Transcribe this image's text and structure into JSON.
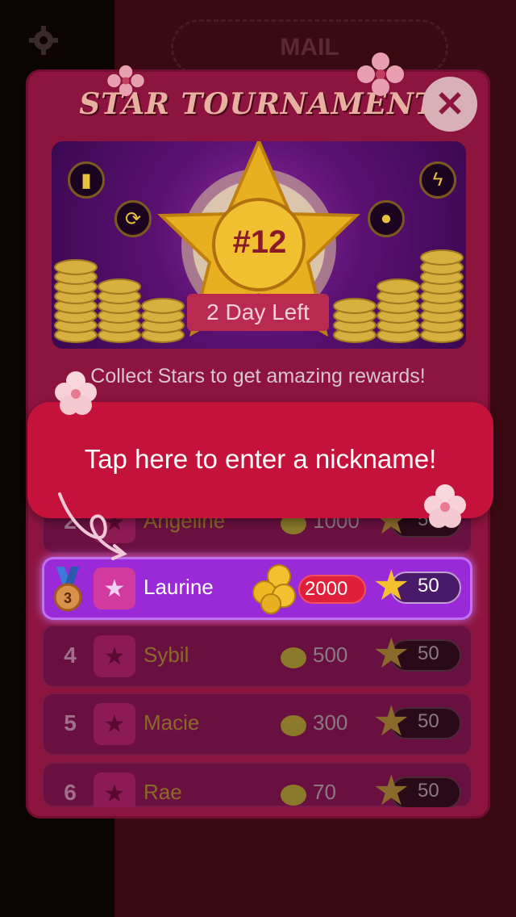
{
  "background": {
    "mail_label": "MAIL"
  },
  "panel": {
    "title": "STAR TOURNAMENT",
    "close_label": "✕"
  },
  "banner": {
    "rank_label": "#12",
    "days_left": "2 Day Left",
    "icons": [
      "bottle-icon",
      "lightning-icon",
      "refresh-icon",
      "lightbulb-icon"
    ]
  },
  "subtitle": "Collect Stars to get amazing rewards!",
  "tooltip": {
    "text": "Tap here to enter a nickname!"
  },
  "leaderboard": [
    {
      "rank": "2",
      "name": "Angeline",
      "coins": "1000",
      "stars": "50",
      "highlight": false
    },
    {
      "rank": "3",
      "name": "Laurine",
      "coins": "2000",
      "stars": "50",
      "highlight": true
    },
    {
      "rank": "4",
      "name": "Sybil",
      "coins": "500",
      "stars": "50",
      "highlight": false
    },
    {
      "rank": "5",
      "name": "Macie",
      "coins": "300",
      "stars": "50",
      "highlight": false
    },
    {
      "rank": "6",
      "name": "Rae",
      "coins": "70",
      "stars": "50",
      "highlight": false
    }
  ],
  "colors": {
    "panel": "#8e1440",
    "tooltip": "#c4123a",
    "highlight_row": "#9a2ad8",
    "gold": "#f5c030"
  }
}
